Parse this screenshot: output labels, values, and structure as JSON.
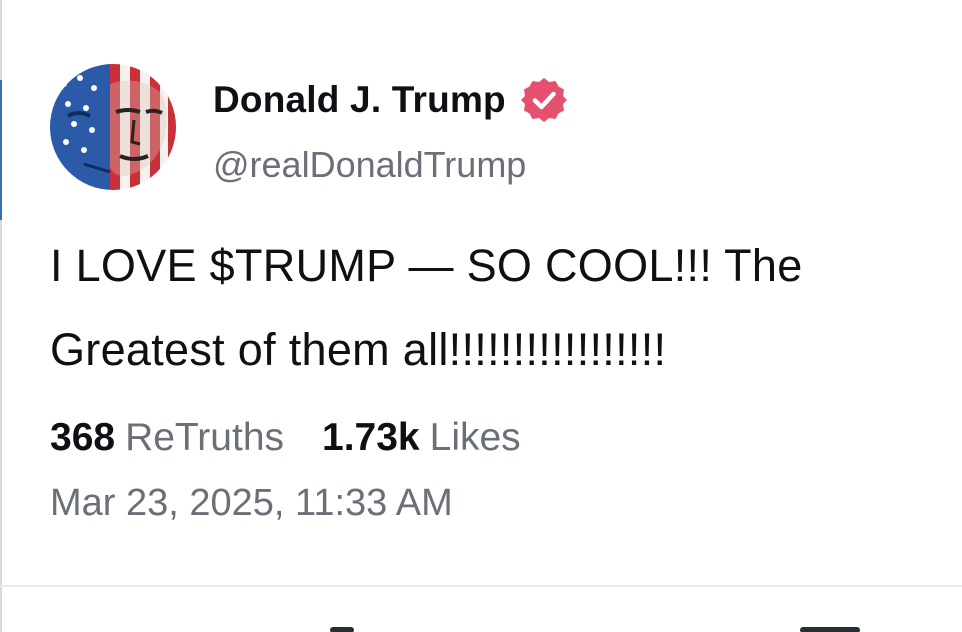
{
  "post": {
    "author": {
      "display_name": "Donald J. Trump",
      "handle": "@realDonaldTrump",
      "verified": true,
      "verified_color": "#e5506f",
      "avatar_icon": "profile-avatar-flag-portrait"
    },
    "text_line_1": "I LOVE $TRUMP — SO COOL!!! The",
    "text_line_2": "Greatest of them all!!!!!!!!!!!!!!!!!",
    "stats": {
      "retruths_count": "368",
      "retruths_label": "ReTruths",
      "likes_count": "1.73k",
      "likes_label": "Likes"
    },
    "timestamp": "Mar 23, 2025, 11:33 AM"
  },
  "colors": {
    "text_primary": "#0f0f14",
    "text_secondary": "#6b6f78",
    "divider": "#e7e8ec"
  }
}
